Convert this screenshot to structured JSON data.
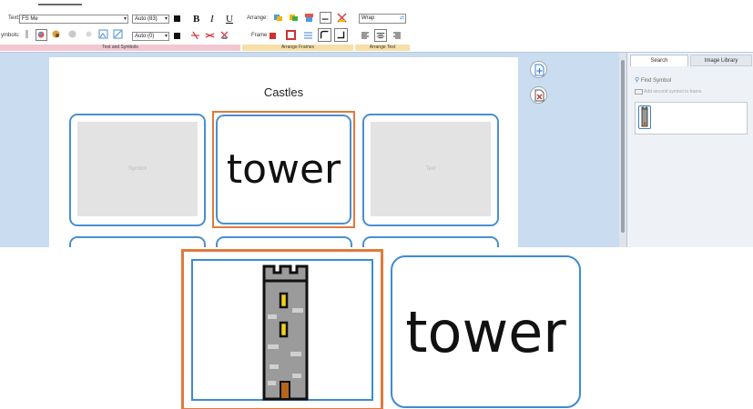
{
  "ribbon": {
    "text_label": "Text:",
    "font_value": "FS Me",
    "text_size_value": "Auto (83)",
    "symbols_label": "ymbols:",
    "symbol_size_value": "Auto (0)",
    "bold_label": "B",
    "italic_label": "I",
    "underline_label": "U",
    "arrange_label": "Arrange:",
    "frame_label": "Frame:",
    "wrap_value": "Wrap",
    "group_text_symbols": "Text and Symbols",
    "group_arrange_frames": "Arrange Frames",
    "group_arrange_text": "Arrange Text"
  },
  "document": {
    "title": "Castles",
    "cards": [
      {
        "type": "placeholder",
        "label": "Symbol"
      },
      {
        "type": "text",
        "label": "tower",
        "selected": true
      },
      {
        "type": "placeholder",
        "label": "Text"
      }
    ]
  },
  "side_buttons": {
    "add_page": "add-page-icon",
    "delete_page": "delete-page-icon"
  },
  "panel": {
    "tabs": [
      "Search",
      "Image Library"
    ],
    "active_tab": "Search",
    "search_placeholder": "Find Symbol",
    "add_second_symbol": "Add second symbol to frame"
  },
  "zoom": {
    "symbol_card": {
      "symbol": "tower-symbol-icon"
    },
    "text_card": {
      "text": "tower"
    }
  },
  "colors": {
    "card_border": "#4a8fd1",
    "selected_frame": "#e07a3c",
    "workspace_bg": "#c9dcf0",
    "group_pink": "#f2c7d1",
    "group_yellow": "#f7dfa8"
  }
}
